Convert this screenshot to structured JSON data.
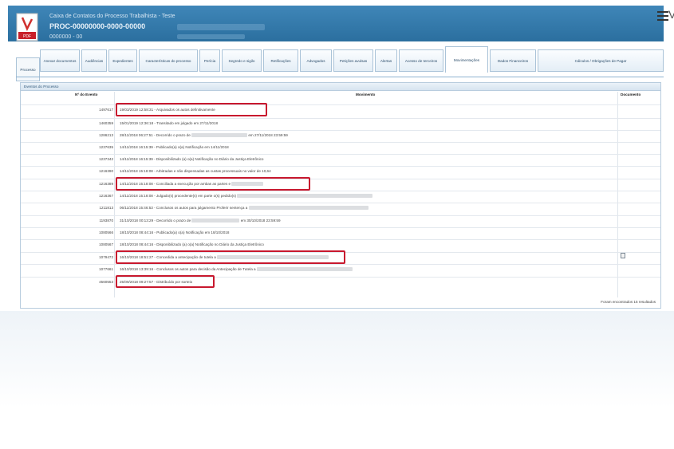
{
  "header": {
    "line1": "Caixa de Contatos do Processo Trabalhista - Teste",
    "line2": "PROC-00000000-0000-00000",
    "line3": "0000000 - 00"
  },
  "tabs": [
    "Anexar documentos",
    "Audiências",
    "Expedientes",
    "Características do processo",
    "Perícia",
    "Segredo e sigilo",
    "Retificações",
    "Advogados",
    "Petições avulsas",
    "Alertas",
    "Acesso de terceiros",
    "Movimentações",
    "Dados Financeiros",
    "Cálculos / Obrigações de Pagar"
  ],
  "active_tab": "Movimentações",
  "side_tab": "Processo",
  "panel": {
    "title": "Eventos do Processo",
    "col_id": "Nº do Evento",
    "col_mov": "Movimento",
    "col_doc": "Documento",
    "footer": "Foram encontrados 15 resultados"
  },
  "rows": [
    {
      "id": "1497617",
      "mov": "19/03/2019 12:58:31 - Arquivados os autos definitivamente"
    },
    {
      "id": "1460359",
      "mov": "15/01/2019 12:36:18 - Transitado em julgado em 27/11/2018"
    },
    {
      "id": "1286213",
      "mov": "28/11/2018 06:27:51 - Decorrido o prazo de",
      "mov2": "em 27/11/2018 23:59:59"
    },
    {
      "id": "1237635",
      "mov": "14/11/2018 16:15:39 - Publicado(a) o(a) Notificação em 14/11/2018"
    },
    {
      "id": "1237342",
      "mov": "14/11/2018 16:15:39 - Disponibilizado (a) o(a) Notificação no Diário da Justiça Eletrônico"
    },
    {
      "id": "1216390",
      "mov": "14/11/2018 15:18:08 - Arbitradas e não dispensadas as custas processuais no valor de 10,64"
    },
    {
      "id": "1216389",
      "mov": "14/11/2018 15:18:08 - Conciliada a execução por ambas as partes e"
    },
    {
      "id": "1216367",
      "mov": "14/11/2018 15:18:08 - Julgado(s) procedente(s) em parte o(s) pedido(s)"
    },
    {
      "id": "1211813",
      "mov": "06/11/2018 15:46:53 - Conclusos os autos para julgamento Proferir sentença a"
    },
    {
      "id": "1193870",
      "mov": "31/10/2018 00:13:29 - Decorrido o prazo de",
      "mov2": "em 30/10/2018 23:59:59"
    },
    {
      "id": "1080566",
      "mov": "18/10/2018 08:44:16 - Publicado(a) o(a) Notificação em 18/10/2018"
    },
    {
      "id": "1080567",
      "mov": "18/10/2018 08:44:16 - Disponibilizado (a) o(a) Notificação no Diário da Justiça Eletrônico"
    },
    {
      "id": "1079472",
      "mov": "16/10/2018 18:51:27 - Concedida a antecipação de tutela a"
    },
    {
      "id": "1077661",
      "mov": "16/10/2018 13:39:16 - Conclusos os autos para decisão da Antecipação de Tutela a"
    },
    {
      "id": "4560553",
      "mov": "25/09/2018 09:27:57 - Distribuído por sorteio"
    }
  ]
}
